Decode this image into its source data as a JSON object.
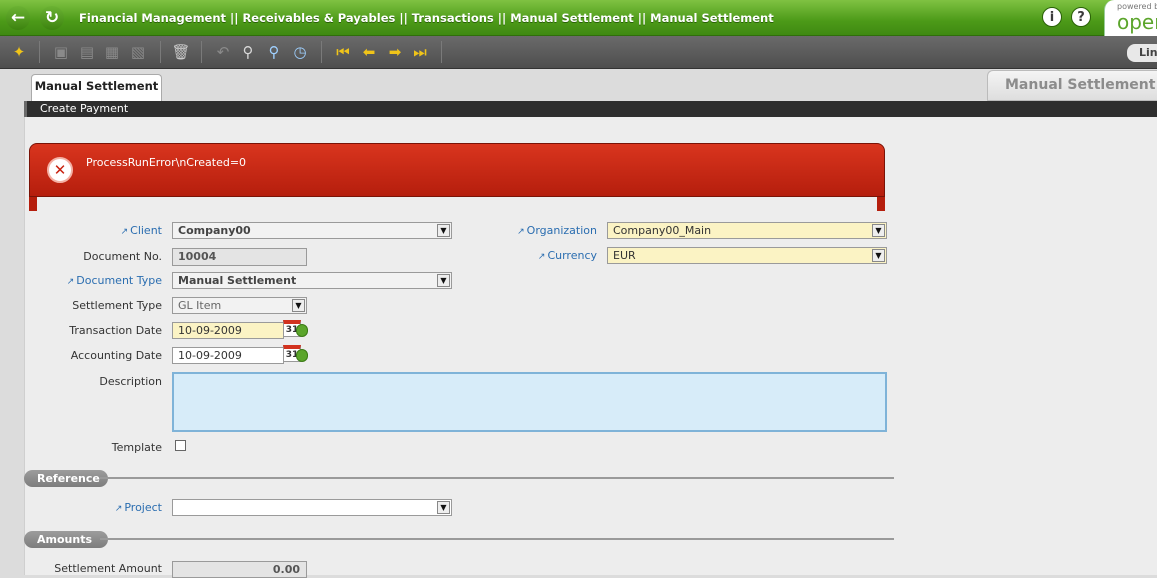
{
  "header": {
    "breadcrumb": "Financial Management || Receivables & Payables || Transactions || Manual Settlement  ||  Manual Settlement",
    "info_icon": "info-icon",
    "help_icon": "help-icon",
    "brand_powered": "powered b",
    "brand_name": "open"
  },
  "toolbar": {
    "link_label": "Lin",
    "icons": [
      "new-record-icon",
      "copy-icon",
      "paste-icon",
      "save-icon",
      "save-new-icon",
      "delete-icon",
      "undo-icon",
      "attach-icon",
      "search-icon",
      "audit-icon",
      "first-icon",
      "previous-icon",
      "next-icon",
      "last-icon"
    ]
  },
  "tabs": {
    "active_tab": "Manual Settlement",
    "window_title": "Manual Settlement",
    "subtab": "Create Payment"
  },
  "message": {
    "text": "ProcessRunError\\nCreated=0",
    "icon": "error-icon"
  },
  "form": {
    "client_label": "Client",
    "client_value": "Company00",
    "organization_label": "Organization",
    "organization_value": "Company00_Main",
    "document_no_label": "Document No.",
    "document_no_value": "10004",
    "currency_label": "Currency",
    "currency_value": "EUR",
    "document_type_label": "Document Type",
    "document_type_value": "Manual Settlement",
    "settlement_type_label": "Settlement Type",
    "settlement_type_value": "GL Item",
    "transaction_date_label": "Transaction Date",
    "transaction_date_value": "10-09-2009",
    "accounting_date_label": "Accounting Date",
    "accounting_date_value": "10-09-2009",
    "calendar_day": "31",
    "description_label": "Description",
    "description_value": "",
    "template_label": "Template",
    "template_checked": false
  },
  "sections": {
    "reference": "Reference",
    "project_label": "Project",
    "project_value": "",
    "amounts": "Amounts",
    "settlement_amount_label": "Settlement Amount",
    "settlement_amount_value": "0.00"
  },
  "colors": {
    "header_green": "#4c9a18",
    "error_red": "#c8210f",
    "required_yellow": "#fbf3c4",
    "description_blue": "#d7ecf9"
  }
}
